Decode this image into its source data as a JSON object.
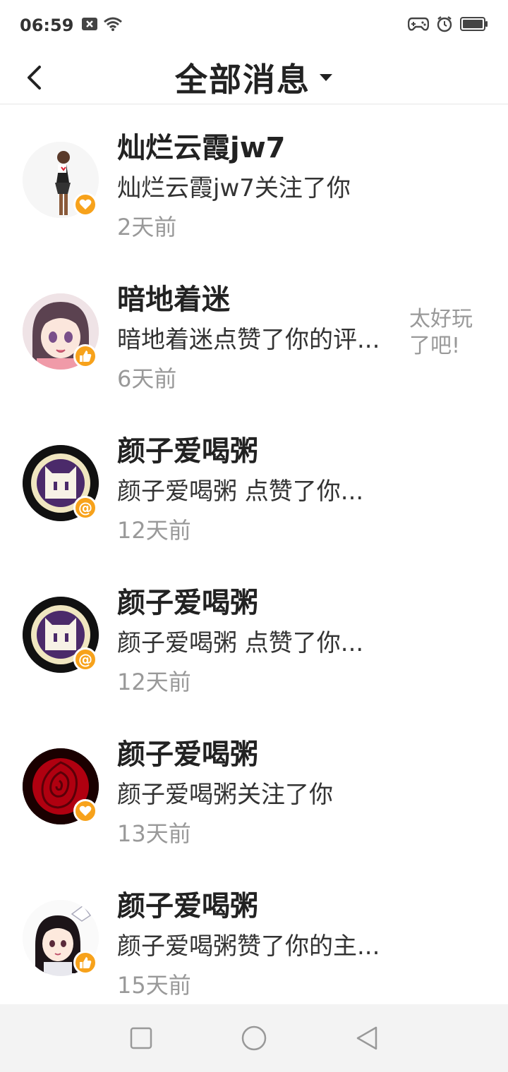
{
  "status_bar": {
    "time": "06:59",
    "left_icons": [
      "sim-x-icon",
      "wifi-icon"
    ],
    "right_icons": [
      "gamepad-icon",
      "alarm-icon",
      "battery-icon"
    ]
  },
  "header": {
    "back_icon": "chevron-left-icon",
    "title": "全部消息",
    "dropdown_icon": "caret-down-icon"
  },
  "messages": [
    {
      "name": "灿烂云霞jw7",
      "text": "灿烂云霞jw7关注了你",
      "time": "2天前",
      "badge": "heart-icon",
      "preview": ""
    },
    {
      "name": "暗地着迷",
      "text": "暗地着迷点赞了你的评...",
      "time": "6天前",
      "badge": "thumbs-up-icon",
      "preview": "太好玩了吧!"
    },
    {
      "name": "颜子爱喝粥",
      "text": "颜子爱喝粥 点赞了你...",
      "time": "12天前",
      "badge": "at-icon",
      "preview": ""
    },
    {
      "name": "颜子爱喝粥",
      "text": "颜子爱喝粥 点赞了你...",
      "time": "12天前",
      "badge": "at-icon",
      "preview": ""
    },
    {
      "name": "颜子爱喝粥",
      "text": "颜子爱喝粥关注了你",
      "time": "13天前",
      "badge": "heart-icon",
      "preview": ""
    },
    {
      "name": "颜子爱喝粥",
      "text": "颜子爱喝粥赞了你的主...",
      "time": "15天前",
      "badge": "thumbs-up-icon",
      "preview": ""
    }
  ],
  "nav_bar": {
    "buttons": [
      "square-icon",
      "circle-icon",
      "triangle-back-icon"
    ]
  },
  "colors": {
    "badge": "#f7a21b",
    "secondary_text": "#999999",
    "nav_bar_bg": "#f3f3f3"
  }
}
